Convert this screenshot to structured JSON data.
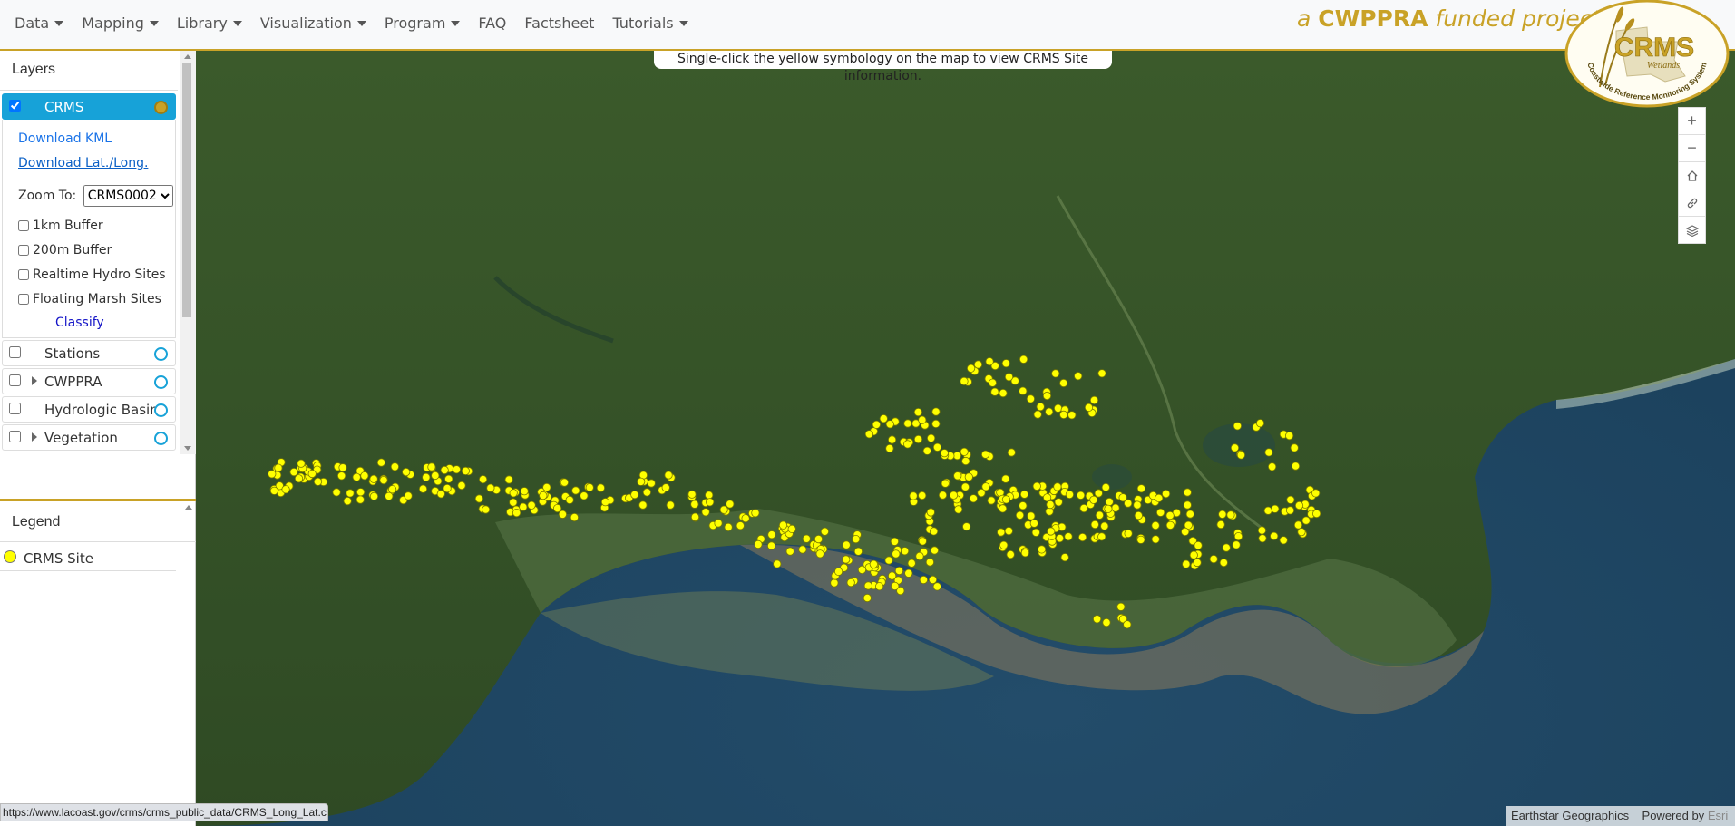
{
  "nav": {
    "menu": [
      {
        "label": "Data",
        "caret": true
      },
      {
        "label": "Mapping",
        "caret": true
      },
      {
        "label": "Library",
        "caret": true
      },
      {
        "label": "Visualization",
        "caret": true
      },
      {
        "label": "Program",
        "caret": true
      },
      {
        "label": "FAQ",
        "caret": false
      },
      {
        "label": "Factsheet",
        "caret": false
      },
      {
        "label": "Tutorials",
        "caret": true
      }
    ],
    "tagline_prefix": "a ",
    "tagline_bold": "CWPPRA",
    "tagline_suffix": " funded project",
    "accent_color": "#c9a227"
  },
  "logo": {
    "title": "CRMS",
    "subtitle": "Wetlands",
    "ring_text": "Coastwide Reference Monitoring System"
  },
  "sidebar": {
    "layers_title": "Layers",
    "layers": [
      {
        "label": "CRMS",
        "checked": true,
        "expandable": false,
        "active": true
      },
      {
        "label": "Stations",
        "checked": false,
        "expandable": false,
        "active": false
      },
      {
        "label": "CWPPRA",
        "checked": false,
        "expandable": true,
        "active": false
      },
      {
        "label": "Hydrologic Basins",
        "checked": false,
        "expandable": false,
        "active": false
      },
      {
        "label": "Vegetation",
        "checked": false,
        "expandable": true,
        "active": false
      }
    ],
    "crms_panel": {
      "download_kml": "Download KML",
      "download_latlong": "Download Lat./Long.",
      "zoom_to_label": "Zoom To:",
      "zoom_to_value": "CRMS0002",
      "options": [
        "1km Buffer",
        "200m Buffer",
        "Realtime Hydro Sites",
        "Floating Marsh Sites"
      ],
      "classify": "Classify"
    },
    "legend_title": "Legend",
    "legend_items": [
      {
        "label": "CRMS Site",
        "color": "#ffff00"
      }
    ]
  },
  "map": {
    "notice": "Single-click the yellow symbology on the map to view CRMS Site information.",
    "controls": [
      "zoom-in-icon",
      "zoom-out-icon",
      "home-icon",
      "link-icon",
      "basemap-layers-icon"
    ],
    "attribution": "Earthstar Geographics",
    "powered_by": "Powered by",
    "esri": "Esri",
    "site_color": "#ffff00"
  },
  "statusbar": {
    "url": "https://www.lacoast.gov/crms/crms_public_data/CRMS_Long_Lat.csv"
  }
}
